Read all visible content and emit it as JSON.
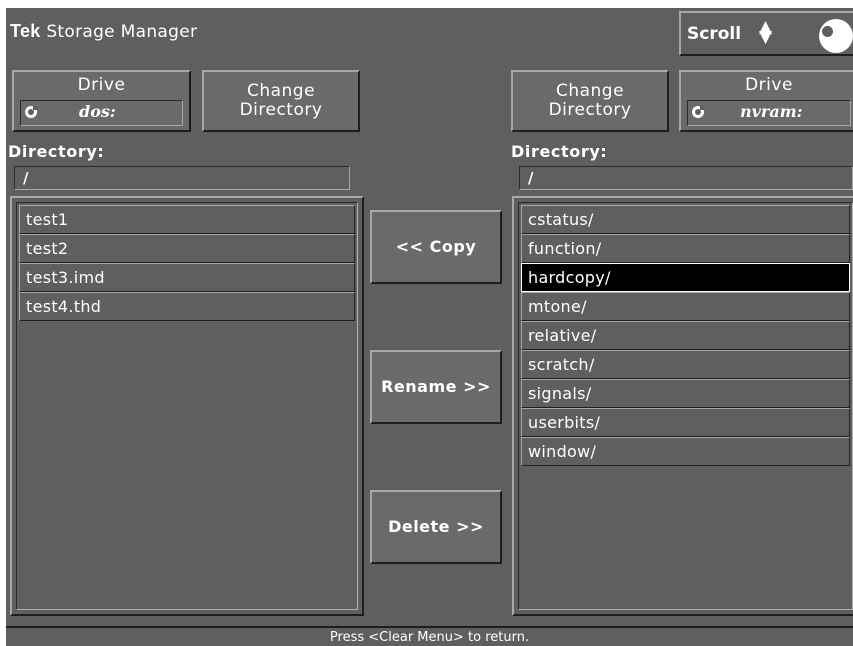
{
  "header": {
    "brand": "Tek",
    "title": "Storage Manager",
    "scroll_label": "Scroll",
    "scroll_arrows_icon": "up-down-arrows-icon",
    "knob_icon": "rotary-knob-icon"
  },
  "left": {
    "drive_label": "Drive",
    "drive_value": "dos:",
    "change_dir_line1": "Change",
    "change_dir_line2": "Directory",
    "directory_label": "Directory:",
    "path": "/",
    "files": [
      "test1",
      "test2",
      "test3.imd",
      "test4.thd"
    ]
  },
  "right": {
    "drive_label": "Drive",
    "drive_value": "nvram:",
    "change_dir_line1": "Change",
    "change_dir_line2": "Directory",
    "directory_label": "Directory:",
    "path": "/",
    "files": [
      "cstatus/",
      "function/",
      "hardcopy/",
      "mtone/",
      "relative/",
      "scratch/",
      "signals/",
      "userbits/",
      "window/"
    ],
    "selected": "hardcopy/"
  },
  "actions": {
    "copy": "<< Copy",
    "rename": "Rename >>",
    "delete": "Delete >>"
  },
  "status": "Press <Clear Menu> to return.",
  "colors": {
    "background": "#5f5f5f",
    "text": "#ffffff",
    "selection": "#000000"
  }
}
